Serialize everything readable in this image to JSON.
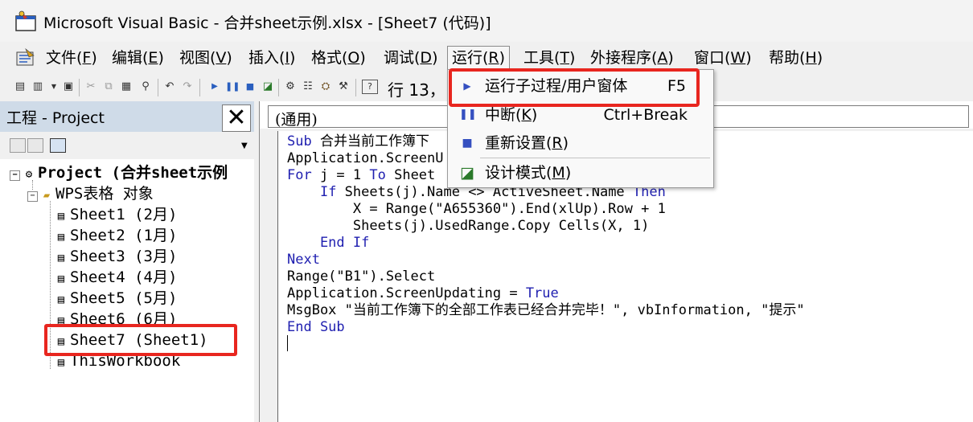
{
  "window": {
    "title": "Microsoft Visual Basic - 合并sheet示例.xlsx - [Sheet7 (代码)]"
  },
  "menubar": {
    "items": [
      {
        "label": "文件(",
        "mnemonic": "F",
        "close": ")"
      },
      {
        "label": "编辑(",
        "mnemonic": "E",
        "close": ")"
      },
      {
        "label": "视图(",
        "mnemonic": "V",
        "close": ")"
      },
      {
        "label": "插入(",
        "mnemonic": "I",
        "close": ")"
      },
      {
        "label": "格式(",
        "mnemonic": "O",
        "close": ")"
      },
      {
        "label": "调试(",
        "mnemonic": "D",
        "close": ")"
      },
      {
        "label": "运行(",
        "mnemonic": "R",
        "close": ")"
      },
      {
        "label": "工具(",
        "mnemonic": "T",
        "close": ")"
      },
      {
        "label": "外接程序(",
        "mnemonic": "A",
        "close": ")"
      },
      {
        "label": "窗口(",
        "mnemonic": "W",
        "close": ")"
      },
      {
        "label": "帮助(",
        "mnemonic": "H",
        "close": ")"
      }
    ]
  },
  "toolbar": {
    "position_text": "行 13，"
  },
  "run_menu": {
    "items": [
      {
        "label": "运行子过程/用户窗体",
        "shortcut": "F5",
        "icon": "play-icon"
      },
      {
        "label": "中断(",
        "mnemonic": "K",
        "close": ")",
        "shortcut": "Ctrl+Break",
        "icon": "pause-icon"
      },
      {
        "label": "重新设置(",
        "mnemonic": "R",
        "close": ")",
        "shortcut": "",
        "icon": "stop-icon"
      },
      {
        "label": "设计模式(",
        "mnemonic": "M",
        "close": ")",
        "shortcut": "",
        "icon": "design-mode-icon"
      }
    ]
  },
  "project": {
    "title": "工程 - Project",
    "close": "✕",
    "tree": {
      "root": "Project (合并sheet示例",
      "folder": "WPS表格 对象",
      "items": [
        "Sheet1 (2月)",
        "Sheet2 (1月)",
        "Sheet3 (3月)",
        "Sheet4 (4月)",
        "Sheet5 (5月)",
        "Sheet6 (6月)",
        "Sheet7 (Sheet1)",
        "ThisWorkbook"
      ]
    }
  },
  "code": {
    "object_combo": "(通用)",
    "lines": [
      "Sub 合并当前工作簿下",
      "Application.ScreenU",
      "For j = 1 To Sheet",
      "    If Sheets(j).Name <> ActiveSheet.Name Then",
      "        X = Range(\"A655360\").End(xlUp).Row + 1",
      "        Sheets(j).UsedRange.Copy Cells(X, 1)",
      "    End If",
      "Next",
      "Range(\"B1\").Select",
      "Application.ScreenUpdating = True",
      "MsgBox \"当前工作簿下的全部工作表已经合并完毕！\", vbInformation, \"提示\"",
      "End Sub"
    ]
  },
  "colors": {
    "keyword": "#1f1fb0",
    "highlight": "#e8261f"
  }
}
